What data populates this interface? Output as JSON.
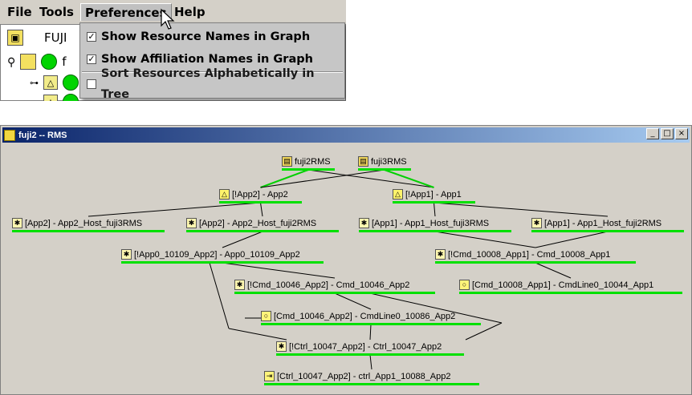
{
  "menubar": {
    "items": [
      "File",
      "Tools",
      "Preferences",
      "Help"
    ]
  },
  "tree": {
    "root_label": "FUJI",
    "row2_label": "f"
  },
  "preferences_menu": {
    "items": [
      {
        "label": "Show Resource Names in Graph",
        "checked": true
      },
      {
        "label": "Show Affiliation Names in Graph",
        "checked": true
      },
      {
        "label": "Sort Resources Alphabetically in Tree",
        "checked": false
      }
    ]
  },
  "graph_window": {
    "title": "fuji2 -- RMS",
    "buttons": [
      "_",
      "□",
      "×"
    ]
  },
  "graph": {
    "nodes": [
      {
        "id": "fuji2rms",
        "label": "fuji2RMS",
        "icon": "rms-icon"
      },
      {
        "id": "fuji3rms",
        "label": "fuji3RMS",
        "icon": "rms-icon"
      },
      {
        "id": "app2",
        "label": "[!App2]  -  App2",
        "icon": "app-icon"
      },
      {
        "id": "app1",
        "label": "[!App1]  -  App1",
        "icon": "app-icon"
      },
      {
        "id": "app2host3",
        "label": "[App2]  -  App2_Host_fuji3RMS",
        "icon": "gear-icon"
      },
      {
        "id": "app2host2",
        "label": "[App2]  -  App2_Host_fuji2RMS",
        "icon": "gear-icon"
      },
      {
        "id": "app1host3",
        "label": "[App1]  -  App1_Host_fuji3RMS",
        "icon": "gear-icon"
      },
      {
        "id": "app1host2",
        "label": "[App1]  -  App1_Host_fuji2RMS",
        "icon": "gear-icon"
      },
      {
        "id": "app0_10109",
        "label": "[!App0_10109_App2]  -  App0_10109_App2",
        "icon": "gear-icon"
      },
      {
        "id": "cmd_10008",
        "label": "[!Cmd_10008_App1]  -  Cmd_10008_App1",
        "icon": "gear-icon"
      },
      {
        "id": "cmd_10046",
        "label": "[!Cmd_10046_App2]  -  Cmd_10046_App2",
        "icon": "gear-icon"
      },
      {
        "id": "cmdline_10044",
        "label": "[Cmd_10008_App1]  -  CmdLine0_10044_App1",
        "icon": "cmdline-icon"
      },
      {
        "id": "cmdline_10086",
        "label": "[Cmd_10046_App2]  -  CmdLine0_10086_App2",
        "icon": "cmdline-icon"
      },
      {
        "id": "ctrl_10047",
        "label": "[!Ctrl_10047_App2]  -  Ctrl_10047_App2",
        "icon": "gear-icon"
      },
      {
        "id": "ctrl_10088",
        "label": "[Ctrl_10047_App2]  -  ctrl_App1_10088_App2",
        "icon": "ctrl-icon"
      }
    ]
  }
}
